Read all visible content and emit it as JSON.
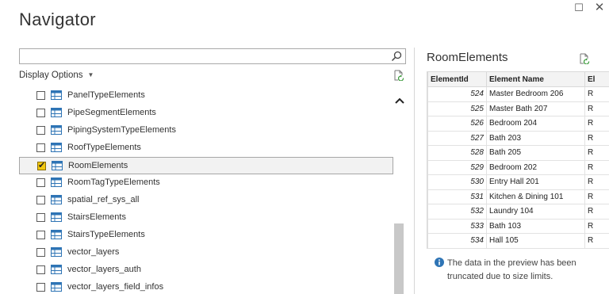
{
  "window": {
    "title": "Navigator",
    "maximize_glyph": "☐",
    "close_glyph": "✕"
  },
  "search": {
    "value": "",
    "placeholder": "",
    "icon": "search-icon"
  },
  "display_options": {
    "label": "Display Options",
    "caret": "▼"
  },
  "nav_list": {
    "items": [
      {
        "label": "PanelTypeElements",
        "checked": false,
        "selected": false
      },
      {
        "label": "PipeSegmentElements",
        "checked": false,
        "selected": false
      },
      {
        "label": "PipingSystemTypeElements",
        "checked": false,
        "selected": false
      },
      {
        "label": "RoofTypeElements",
        "checked": false,
        "selected": false
      },
      {
        "label": "RoomElements",
        "checked": true,
        "selected": true
      },
      {
        "label": "RoomTagTypeElements",
        "checked": false,
        "selected": false
      },
      {
        "label": "spatial_ref_sys_all",
        "checked": false,
        "selected": false
      },
      {
        "label": "StairsElements",
        "checked": false,
        "selected": false
      },
      {
        "label": "StairsTypeElements",
        "checked": false,
        "selected": false
      },
      {
        "label": "vector_layers",
        "checked": false,
        "selected": false
      },
      {
        "label": "vector_layers_auth",
        "checked": false,
        "selected": false
      },
      {
        "label": "vector_layers_field_infos",
        "checked": false,
        "selected": false
      }
    ]
  },
  "preview": {
    "title": "RoomElements",
    "columns": [
      "ElementId",
      "Element Name",
      "El"
    ],
    "rows": [
      {
        "id": "524",
        "name": "Master Bedroom 206",
        "third": "R"
      },
      {
        "id": "525",
        "name": "Master Bath 207",
        "third": "R"
      },
      {
        "id": "526",
        "name": "Bedroom 204",
        "third": "R"
      },
      {
        "id": "527",
        "name": "Bath 203",
        "third": "R"
      },
      {
        "id": "528",
        "name": "Bath 205",
        "third": "R"
      },
      {
        "id": "529",
        "name": "Bedroom 202",
        "third": "R"
      },
      {
        "id": "530",
        "name": "Entry Hall 201",
        "third": "R"
      },
      {
        "id": "531",
        "name": "Kitchen & Dining 101",
        "third": "R"
      },
      {
        "id": "532",
        "name": "Laundry 104",
        "third": "R"
      },
      {
        "id": "533",
        "name": "Bath 103",
        "third": "R"
      },
      {
        "id": "534",
        "name": "Hall 105",
        "third": "R"
      }
    ],
    "info_text": "The data in the preview has been truncated due to size limits."
  },
  "colors": {
    "checkbox_checked": "#f2c811",
    "table_icon_blue": "#2e74b5",
    "info_blue": "#2e74b5",
    "selected_row": "#f2f2f2"
  }
}
